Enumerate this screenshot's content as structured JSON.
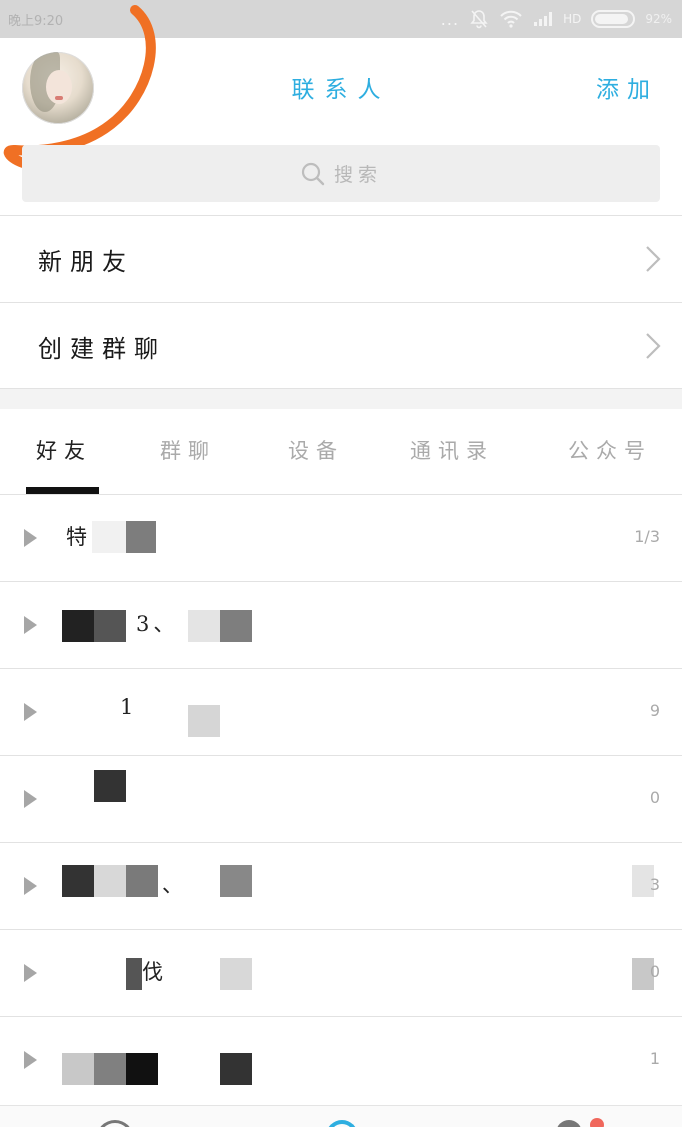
{
  "status_bar": {
    "time": "晚上9:20",
    "dots": "...",
    "network": "HD",
    "battery_pct": "92%",
    "battery_level": 0.92
  },
  "header": {
    "title": "联系人",
    "add_label": "添加",
    "annotation_color": "#f07024"
  },
  "search": {
    "placeholder": "搜索"
  },
  "menu": [
    {
      "label": "新朋友"
    },
    {
      "label": "创建群聊"
    }
  ],
  "tabs": [
    {
      "label": "好友",
      "active": true
    },
    {
      "label": "群聊",
      "active": false
    },
    {
      "label": "设备",
      "active": false
    },
    {
      "label": "通讯录",
      "active": false
    },
    {
      "label": "公众号",
      "active": false
    }
  ],
  "groups": [
    {
      "name_visible": "特 关心",
      "count": "1/3"
    },
    {
      "name_visible": "3、",
      "count": ""
    },
    {
      "name_visible": "1",
      "count": "9"
    },
    {
      "name_visible": "",
      "count": "0"
    },
    {
      "name_visible": "、",
      "count": "3"
    },
    {
      "name_visible": "伐",
      "count": "0"
    },
    {
      "name_visible": "",
      "count": "1"
    }
  ],
  "colors": {
    "accent": "#2eaee0",
    "text": "#222222",
    "muted": "#aaaaaa",
    "badge": "#f0675c"
  }
}
